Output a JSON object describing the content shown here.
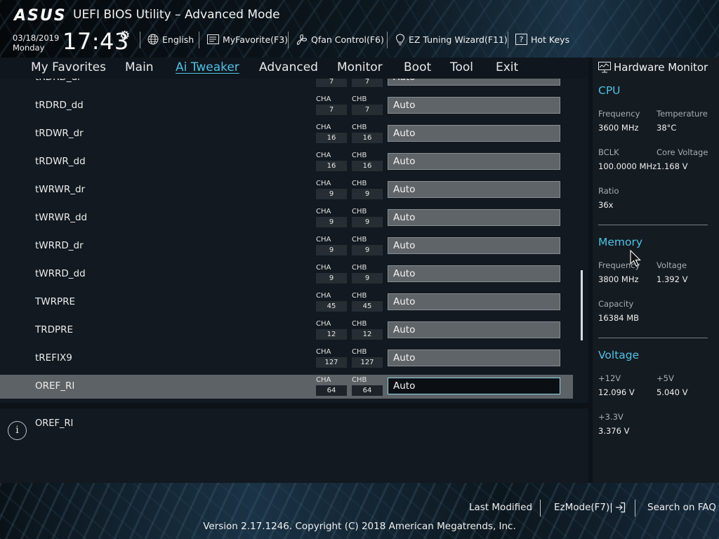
{
  "header": {
    "logo": "ASUS",
    "title": "UEFI BIOS Utility – Advanced Mode",
    "date": "03/18/2019",
    "day": "Monday",
    "time": "17:43",
    "toolbar": [
      {
        "label": "English",
        "icon": "globe-icon"
      },
      {
        "label": "MyFavorite(F3)",
        "icon": "favorite-list-icon"
      },
      {
        "label": "Qfan Control(F6)",
        "icon": "fan-icon"
      },
      {
        "label": "EZ Tuning Wizard(F11)",
        "icon": "lightbulb-icon"
      },
      {
        "label": "Hot Keys",
        "icon": "help-key-icon"
      }
    ]
  },
  "nav": {
    "tabs": [
      "My Favorites",
      "Main",
      "Ai Tweaker",
      "Advanced",
      "Monitor",
      "Boot",
      "Tool",
      "Exit"
    ],
    "active": "Ai Tweaker"
  },
  "settings": {
    "channel_labels": [
      "CHA",
      "CHB"
    ],
    "rows": [
      {
        "name": "tRDRD_dr",
        "cha": "7",
        "chb": "7",
        "value": "Auto"
      },
      {
        "name": "tRDRD_dd",
        "cha": "7",
        "chb": "7",
        "value": "Auto"
      },
      {
        "name": "tRDWR_dr",
        "cha": "16",
        "chb": "16",
        "value": "Auto"
      },
      {
        "name": "tRDWR_dd",
        "cha": "16",
        "chb": "16",
        "value": "Auto"
      },
      {
        "name": "tWRWR_dr",
        "cha": "9",
        "chb": "9",
        "value": "Auto"
      },
      {
        "name": "tWRWR_dd",
        "cha": "9",
        "chb": "9",
        "value": "Auto"
      },
      {
        "name": "tWRRD_dr",
        "cha": "9",
        "chb": "9",
        "value": "Auto"
      },
      {
        "name": "tWRRD_dd",
        "cha": "9",
        "chb": "9",
        "value": "Auto"
      },
      {
        "name": "TWRPRE",
        "cha": "45",
        "chb": "45",
        "value": "Auto"
      },
      {
        "name": "TRDPRE",
        "cha": "12",
        "chb": "12",
        "value": "Auto"
      },
      {
        "name": "tREFIX9",
        "cha": "127",
        "chb": "127",
        "value": "Auto"
      },
      {
        "name": "OREF_RI",
        "cha": "64",
        "chb": "64",
        "value": "Auto"
      }
    ],
    "selected_row": "OREF_RI"
  },
  "help": {
    "text": "OREF_RI"
  },
  "hardware_monitor": {
    "title": "Hardware Monitor",
    "cpu": {
      "title": "CPU",
      "frequency_label": "Frequency",
      "frequency": "3600 MHz",
      "temperature_label": "Temperature",
      "temperature": "38°C",
      "bclk_label": "BCLK",
      "bclk": "100.0000 MHz",
      "core_voltage_label": "Core Voltage",
      "core_voltage": "1.168 V",
      "ratio_label": "Ratio",
      "ratio": "36x"
    },
    "memory": {
      "title": "Memory",
      "frequency_label": "Frequency",
      "frequency": "3800 MHz",
      "voltage_label": "Voltage",
      "voltage": "1.392 V",
      "capacity_label": "Capacity",
      "capacity": "16384 MB"
    },
    "voltage": {
      "title": "Voltage",
      "v12_label": "+12V",
      "v12": "12.096 V",
      "v5_label": "+5V",
      "v5": "5.040 V",
      "v33_label": "+3.3V",
      "v33": "3.376 V"
    }
  },
  "footer": {
    "last_modified": "Last Modified",
    "ezmode": "EzMode(F7)|",
    "search_faq": "Search on FAQ",
    "copyright": "Version 2.17.1246. Copyright (C) 2018 American Megatrends, Inc."
  },
  "colors": {
    "accent": "#4ec3e6",
    "selected_row": "#5d6266",
    "input_bg": "#5f6468"
  }
}
